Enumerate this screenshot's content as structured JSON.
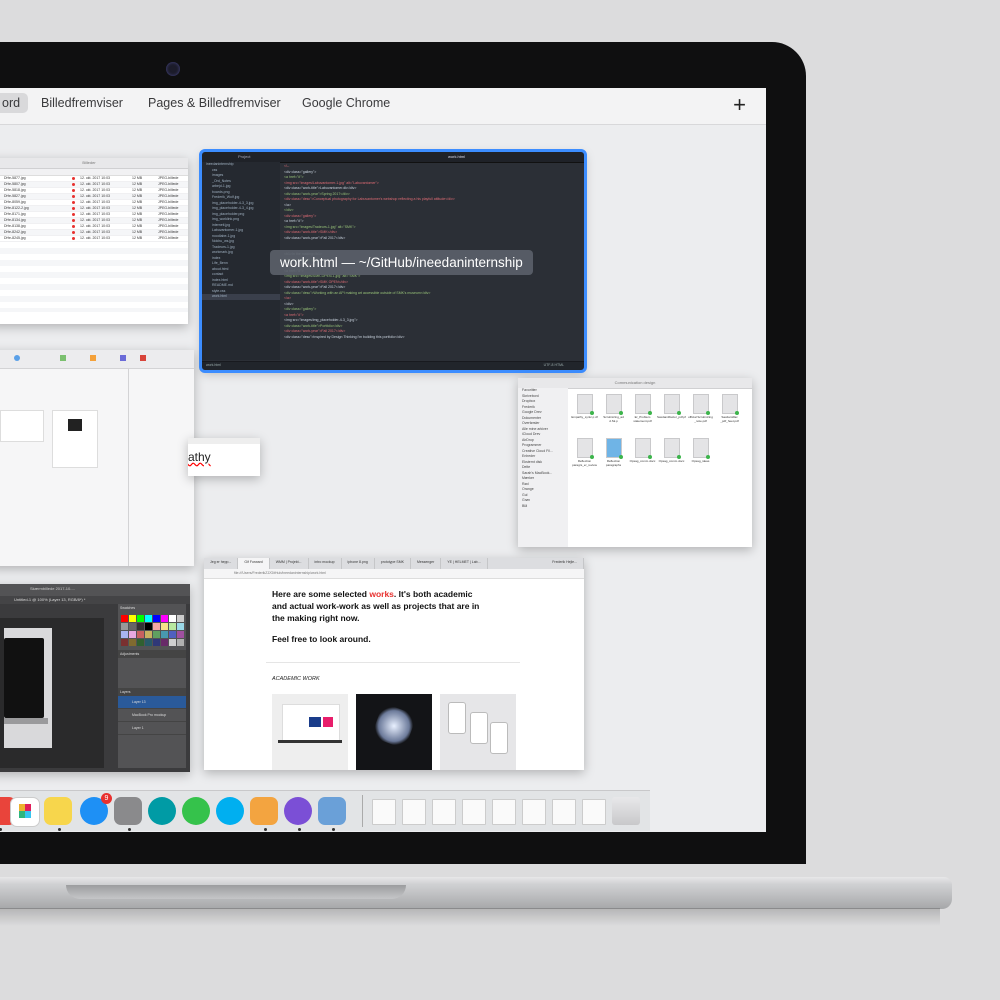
{
  "spaces_bar": {
    "tabs": [
      "ord",
      "Billedfremviser",
      "Pages & Billedfremviser",
      "Google Chrome"
    ],
    "active_index": 0,
    "add_label": "+"
  },
  "editor_window": {
    "label": "work.html — ~/GitHub/ineedaninternship",
    "title_left": "Project",
    "title_right": "work.html",
    "sidebar_items": [
      "ineedaninternship",
      "css",
      "images",
      "_Ord_Notes",
      "arbejd-1.jpg",
      "boards.png",
      "Frederik_Wolf.jpg",
      "img_placeholder-4-3_3.jpg",
      "img_placeholder-4-3_4.jpg",
      "img_placeholder.png",
      "img_worklink.png",
      "interneti.jpg",
      "Labuvantomer-1.jpg",
      "noodlabe-1.jpg",
      "Nokhu_ws.jpg",
      "Tradeurs-1.jpg",
      "workmark.jpg",
      "index",
      "Life_Benn",
      "about.html",
      "contact",
      "index.html",
      "README.md",
      "style.css",
      "work.html"
    ],
    "code_lines": [
      "<!--",
      "<div class=\"gallery\">",
      "  <a href=\"#\">",
      "    <img src=\"images/Labuvantomer-1.jpg\" alt=\"Labuvantomer\">",
      "    <div class=\"work-title\">Labuvantomer.dk</div>",
      "    <div class=\"work-year\">Spring 2017</div>",
      "    <div class=\"desc\">Conceptual photography for Labuvantomer's webshop reflecting a his playfull attitude</div>",
      "  </a>",
      "</div>",
      "<div class=\"gallery\">",
      "  <a href=\"#\">",
      "    <img src=\"images/Tradeurs-1.jpg\" alt=\"SMK\">",
      "    <div class=\"work-title\">SMK</div>",
      "    <div class=\"work-year\">Fall 2017</div>",
      "",
      "",
      "<h1>In the making</h1>",
      "<div class=\"work-grid\">",
      "  <div class=\"gallery\">",
      "    <a href=\"#\">",
      "      <img src=\"images/SMK-OPEN-1.jpg\" alt=\"SMK\">",
      "      <div class=\"work-title\">SMK OPEN</div>",
      "      <div class=\"work-year\">Fall 2017</div>",
      "      <div class=\"desc\">Working with an API making art accessible outside of SMK's museum</div>",
      "    </a>",
      "  </div>",
      "  <div class=\"gallery\">",
      "    <a href=\"#\">",
      "      <img src=\"images/img_placeholder-4-3_3.jpg\">",
      "      <div class=\"work-title\">Portfolio</div>",
      "      <div class=\"work-year\">Fall 2017</div>",
      "      <div class=\"desc\">Inspired by Design Thinking I'm building this portfolio</div>"
    ],
    "status_left": "work.html",
    "status_right": "UTF-8   HTML"
  },
  "finder_list_window": {
    "title": "Billeder",
    "rows": [
      {
        "name": "DHe-5877.jpg",
        "date": "12. okt. 2017 10:03",
        "size": "12 MB",
        "kind": "JPEG-billede"
      },
      {
        "name": "DHe-5807.jpg",
        "date": "12. okt. 2017 10:03",
        "size": "12 MB",
        "kind": "JPEG-billede"
      },
      {
        "name": "DHe-5818.jpg",
        "date": "12. okt. 2017 10:03",
        "size": "12 MB",
        "kind": "JPEG-billede"
      },
      {
        "name": "DHe-5827.jpg",
        "date": "12. okt. 2017 10:03",
        "size": "12 MB",
        "kind": "JPEG-billede"
      },
      {
        "name": "DHe-8059.jpg",
        "date": "12. okt. 2017 10:03",
        "size": "12 MB",
        "kind": "JPEG-billede"
      },
      {
        "name": "DHe-8122-2.jpg",
        "date": "12. okt. 2017 10:03",
        "size": "12 MB",
        "kind": "JPEG-billede"
      },
      {
        "name": "DHe-8171.jpg",
        "date": "12. okt. 2017 10:03",
        "size": "12 MB",
        "kind": "JPEG-billede"
      },
      {
        "name": "DHe-8134.jpg",
        "date": "12. okt. 2017 10:03",
        "size": "12 MB",
        "kind": "JPEG-billede"
      },
      {
        "name": "DHe-8138.jpg",
        "date": "12. okt. 2017 10:03",
        "size": "12 MB",
        "kind": "JPEG-billede"
      },
      {
        "name": "DHe-8242.jpg",
        "date": "12. okt. 2017 10:03",
        "size": "12 MB",
        "kind": "JPEG-billede"
      },
      {
        "name": "DHe-8245.jpg",
        "date": "12. okt. 2017 10:03",
        "size": "12 MB",
        "kind": "JPEG-billede"
      }
    ]
  },
  "pages_window": {
    "fragment_text": "athy"
  },
  "finder_icon_window": {
    "title": "Communication design",
    "sidebar": [
      "Favoritter",
      "Skrivebord",
      "Dropbox",
      "Frederik",
      "Google Drev",
      "Dokumenter",
      "Overførsler",
      "Alle mine arkiver",
      "iCloud Drev",
      "AirDrop",
      "Programmer",
      "Creative Cloud Fil...",
      "Enheder",
      "Eksternt disk",
      "Delte",
      "Sarah's MacBook...",
      "Mærker",
      "Rød",
      "Orange",
      "Gul",
      "Grøn",
      "Blå"
    ],
    "files": [
      "Empathy_syntc.p df",
      "Scrutinizing_ad d.Sk.p",
      "Er_Problem statement.pdf",
      "Saxdamilfactor_pdf.pf",
      "official Scrutinizing _note.pdf",
      "Saxdamilfac _pdf_heet.pdf",
      "Reflection paragrs_er_review",
      "Reflection paragraphs",
      "Opsag_comm.docx",
      "Opsag_comm.docx",
      "Opsag_ideas"
    ]
  },
  "chrome_window": {
    "tabs": [
      "Jeg er hepp...",
      "Gif Forward",
      "WMM | Projekt...",
      "intro mockup",
      "iphone 8.png",
      "prototype SMK",
      "Messenger",
      "YE | HELMET | Lab..."
    ],
    "profile": "Frederik Hejle...",
    "url": "file:///Users/FrederikZZ/GitHub/ineedaninternship/work.html",
    "intro_before": "Here are some selected ",
    "intro_highlight": "works",
    "intro_after": ". It's both academic and actual work-work as well as projects that are in the making right now.",
    "sub": "Feel free to look around.",
    "section_title": "ACADEMIC WORK",
    "accent": "#e8312f"
  },
  "photoshop_window": {
    "doc_title": "Untitled-1 @ 100% (Layer 13, RGB/8*) *",
    "date": "Skærmbillede 2017-10-...",
    "panel_tabs": [
      "Swatches",
      "Adjustments",
      "Styles"
    ],
    "layers_tabs": [
      "Layers",
      "Channels",
      "Paths"
    ],
    "layers": [
      "Layer 13",
      "MacBook Pro mockup",
      "Layer 1"
    ]
  },
  "dock": {
    "badge": "9"
  }
}
